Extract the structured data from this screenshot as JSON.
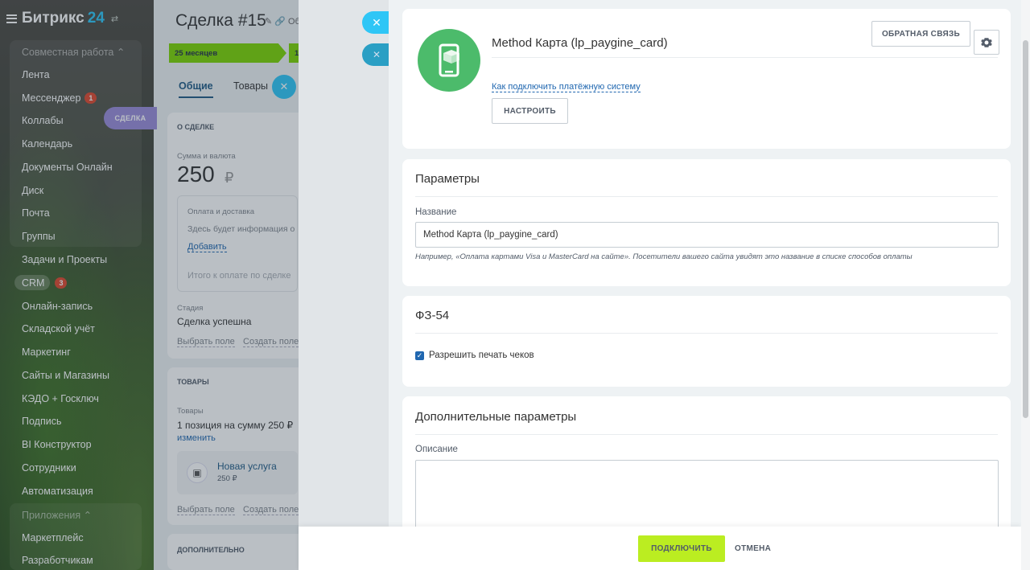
{
  "sidebar": {
    "brand": "Битрикс",
    "brand_num": "24",
    "section_collab": "Совместная работа ⌃",
    "items": [
      "Лента",
      "Мессенджер",
      "Коллабы",
      "Календарь",
      "Документы Онлайн",
      "Диск",
      "Почта",
      "Группы",
      "Задачи и Проекты",
      "CRM",
      "Онлайн-запись",
      "Складской учёт",
      "Маркетинг",
      "Сайты и Магазины",
      "КЭДО + Госключ",
      "Подпись",
      "BI Конструктор",
      "Сотрудники",
      "Автоматизация"
    ],
    "messenger_counter": "1",
    "crm_counter": "3",
    "section_apps": "Приложения ⌃",
    "apps_items": [
      "Маркетплейс",
      "Разработчикам"
    ],
    "deal_tag": "СДЕЛКА"
  },
  "deal": {
    "title": "Сделка #15",
    "title_tools": "✎ 🔗 Об",
    "stage": "25 месяцев",
    "stage2": "1",
    "tabs": [
      "Общие",
      "Товары"
    ],
    "about_head": "О СДЕЛКЕ",
    "sum_label": "Сумма и валюта",
    "sum_value": "250",
    "currency": "₽",
    "pay_head": "Оплата и доставка",
    "pay_text": "Здесь будет информация о",
    "pay_add": "Добавить",
    "total_label": "Итого к оплате по сделке",
    "stage_label": "Стадия",
    "stage_value": "Сделка успешна",
    "choose_field": "Выбрать поле",
    "create_field": "Создать поле",
    "goods_head": "ТОВАРЫ",
    "goods_label": "Товары",
    "goods_value": "1 позиция на сумму 250 ₽",
    "goods_change": "изменить",
    "product_name": "Новая услуга",
    "product_price": "250 ₽",
    "extra_head": "ДОПОЛНИТЕЛЬНО"
  },
  "payment": {
    "name": "Method Карта (lp_paygine_card)",
    "feedback_btn": "ОБРАТНАЯ СВЯЗЬ",
    "how_link": "Как подключить платёжную систему",
    "setup_btn": "НАСТРОИТЬ",
    "logo_color": "#4cbb6b"
  },
  "params": {
    "title": "Параметры",
    "name_label": "Название",
    "name_value": "Method Карта (lp_paygine_card)",
    "hint": "Например, «Оплата картами Visa и MasterCard на сайте». Посетители вашего сайта увидят это название в списке способов оплаты"
  },
  "fz54": {
    "title": "ФЗ-54",
    "checkbox_label": "Разрешить печать чеков",
    "checked": true
  },
  "extra": {
    "title": "Дополнительные параметры",
    "desc_label": "Описание"
  },
  "footer": {
    "connect_btn": "ПОДКЛЮЧИТЬ",
    "cancel_btn": "ОТМЕНА",
    "accent": "#bbed21"
  }
}
